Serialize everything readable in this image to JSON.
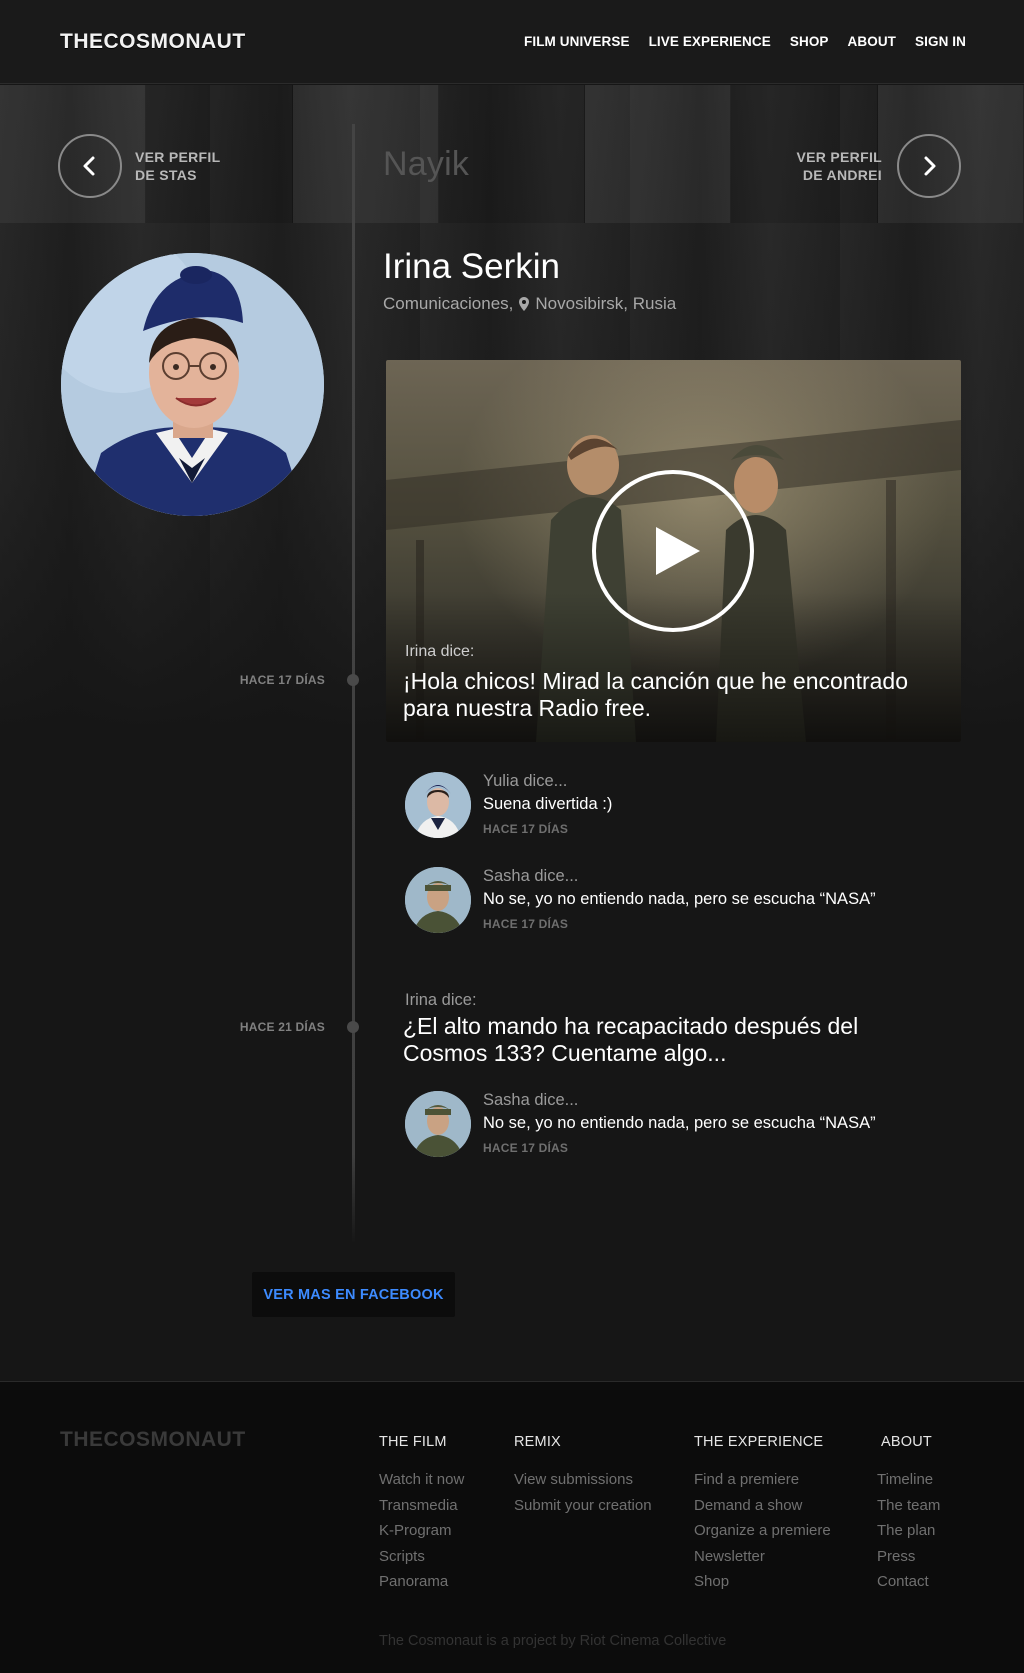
{
  "header": {
    "logo": "THECOSMONAUT",
    "nav": [
      "FILM UNIVERSE",
      "LIVE EXPERIENCE",
      "SHOP",
      "ABOUT",
      "SIGN IN"
    ]
  },
  "profile_nav": {
    "prev_line1": "VER PERFIL",
    "prev_line2": "DE STAS",
    "next_line1": "VER PERFIL",
    "next_line2": "DE ANDREI",
    "group": "Nayik"
  },
  "profile": {
    "name": "Irina Serkin",
    "role": "Comunicaciones,",
    "location": "Novosibirsk, Rusia"
  },
  "timeline": {
    "post1": {
      "date": "HACE 17 DÍAS",
      "author": "Irina dice:",
      "text": "¡Hola chicos! Mirad la canción que he encontrado para nuestra Radio free."
    },
    "post1_comments": [
      {
        "author": "Yulia dice...",
        "text": "Suena divertida :)",
        "date": "HACE 17 DÍAS"
      },
      {
        "author": "Sasha dice...",
        "text": "No se, yo no entiendo nada, pero se escucha “NASA”",
        "date": "HACE 17 DÍAS"
      }
    ],
    "post2": {
      "date": "HACE 21 DÍAS",
      "author": "Irina dice:",
      "text": "¿El alto mando ha recapacitado después del Cosmos 133? Cuentame algo..."
    },
    "post2_comments": [
      {
        "author": "Sasha dice...",
        "text": "No se, yo no entiendo nada, pero se escucha “NASA”",
        "date": "HACE 17 DÍAS"
      }
    ]
  },
  "facebook_button": "VER MAS EN FACEBOOK",
  "footer": {
    "logo": "THECOSMONAUT",
    "columns": [
      {
        "title": "THE FILM",
        "links": [
          "Watch it now",
          "Transmedia",
          "K-Program",
          "Scripts",
          "Panorama"
        ]
      },
      {
        "title": "REMIX",
        "links": [
          "View submissions",
          "Submit your creation"
        ]
      },
      {
        "title": "THE EXPERIENCE",
        "links": [
          "Find a premiere",
          "Demand a show",
          "Organize a premiere",
          "Newsletter",
          "Shop"
        ]
      },
      {
        "title": "ABOUT",
        "links": [
          "Timeline",
          "The team",
          "The plan",
          "Press",
          "Contact"
        ]
      }
    ],
    "credit": "The Cosmonaut is a project by Riot Cinema Collective"
  },
  "colors": {
    "background": "#161616",
    "accent_link": "#3d8bff",
    "footer_bg": "#0c0c0c"
  },
  "icons": {
    "prev": "chevron-left-icon",
    "next": "chevron-right-icon",
    "play": "play-icon",
    "location": "map-pin-icon"
  }
}
